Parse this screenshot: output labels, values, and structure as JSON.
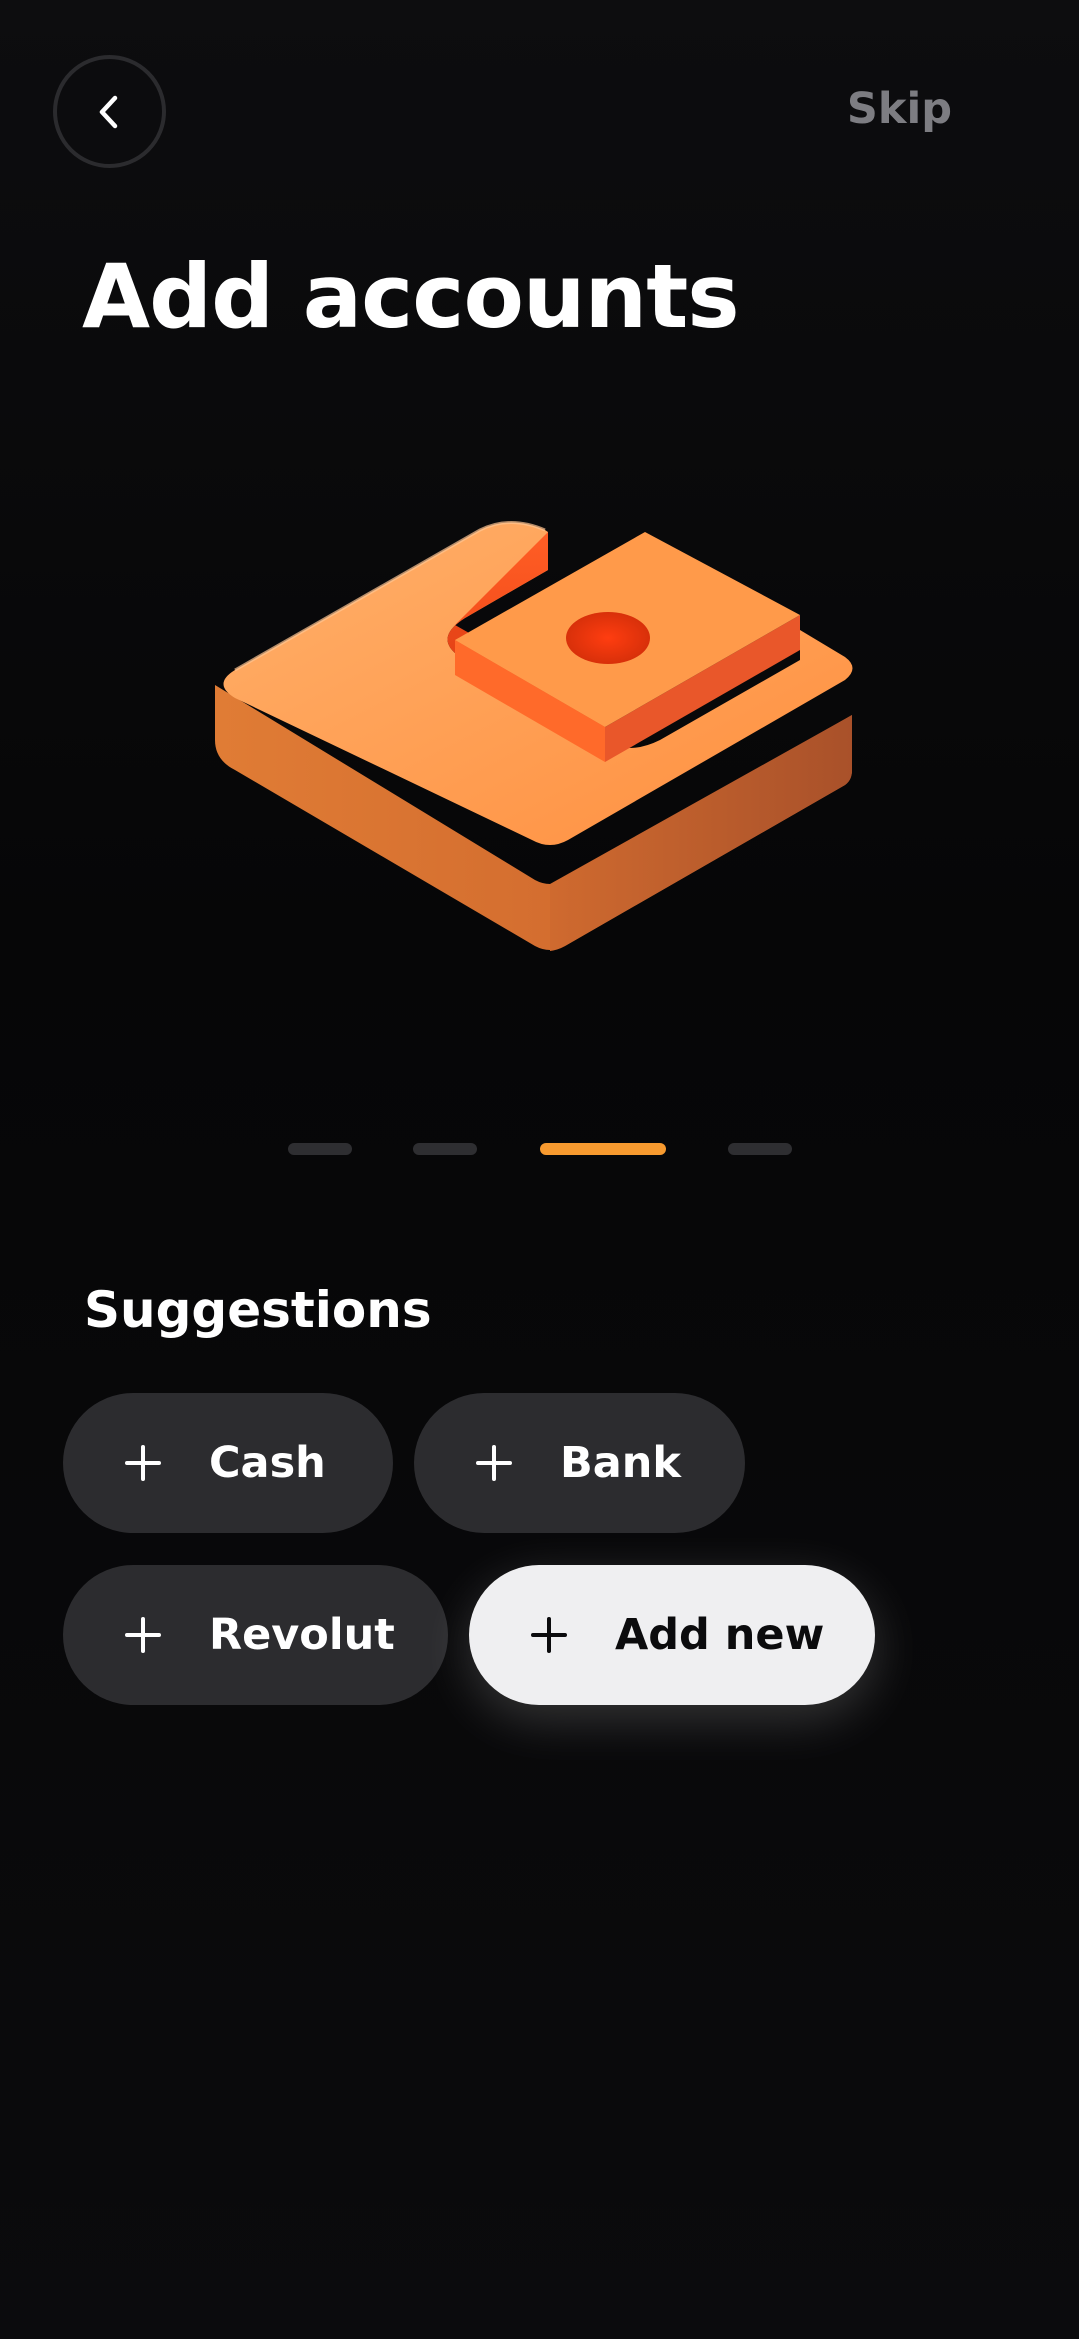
{
  "header": {
    "back_icon": "chevron-left-icon",
    "skip_label": "Skip"
  },
  "title": "Add accounts",
  "hero": {
    "icon": "wallet-3d-icon",
    "colors": {
      "top": "#ffa258",
      "side": "#d9682a",
      "inner": "#ff4a17"
    }
  },
  "pager": {
    "count": 4,
    "active_index": 2,
    "active_color": "#f79a2f",
    "inactive_color": "#2e2e31"
  },
  "suggestions": {
    "title": "Suggestions",
    "items": [
      {
        "label": "Cash",
        "icon": "plus-icon"
      },
      {
        "label": "Bank",
        "icon": "plus-icon"
      },
      {
        "label": "Revolut",
        "icon": "plus-icon"
      }
    ],
    "add_new": {
      "label": "Add new",
      "icon": "plus-icon"
    }
  }
}
